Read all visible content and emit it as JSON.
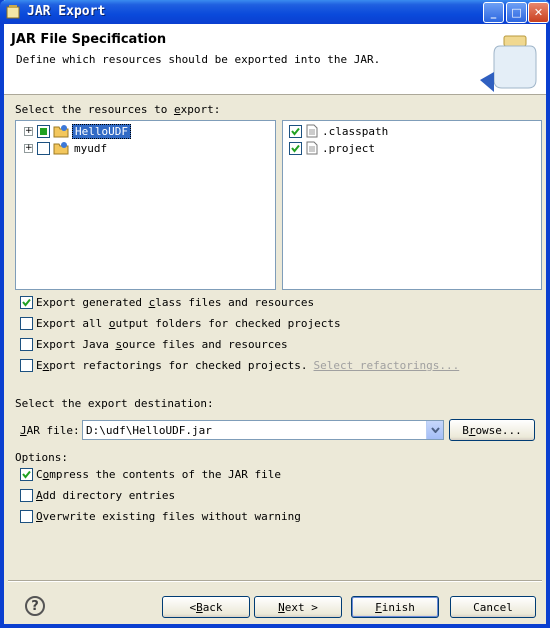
{
  "window": {
    "title": "JAR Export",
    "buttons": {
      "minimize": "_",
      "maximize": "□",
      "close": "✕"
    }
  },
  "header": {
    "title": "JAR File Specification",
    "description": "Define which resources should be exported into the JAR."
  },
  "resources": {
    "label_pre": "Select the resources to ",
    "label_u": "e",
    "label_post": "xport:",
    "projects": [
      {
        "name": "HelloUDF",
        "state": "partial",
        "selected": true,
        "expander": "+"
      },
      {
        "name": "myudf",
        "state": "unchecked",
        "selected": false,
        "expander": "+"
      }
    ],
    "files": [
      {
        "name": ".classpath",
        "checked": true
      },
      {
        "name": ".project",
        "checked": true
      }
    ]
  },
  "export_options": [
    {
      "pre": "Export generated ",
      "u": "c",
      "post": "lass files and resources",
      "checked": true
    },
    {
      "pre": "Export all ",
      "u": "o",
      "post": "utput folders for checked projects",
      "checked": false
    },
    {
      "pre": "Export Java ",
      "u": "s",
      "post": "ource files and resources",
      "checked": false
    },
    {
      "pre": "E",
      "u": "x",
      "post": "port refactorings for checked projects.",
      "checked": false,
      "link": "Select refactorings..."
    }
  ],
  "destination": {
    "label": "Select the export destination:",
    "jar_file_label_u": "J",
    "jar_file_label_post": "AR file:",
    "jar_file_value": "D:\\udf\\HelloUDF.jar",
    "browse_pre": "B",
    "browse_u": "r",
    "browse_post": "owse..."
  },
  "options": {
    "label": "Options:",
    "items": [
      {
        "pre": "C",
        "u": "o",
        "post": "mpress the contents of the JAR file",
        "checked": true
      },
      {
        "pre": "",
        "u": "A",
        "post": "dd directory entries",
        "checked": false
      },
      {
        "pre": "",
        "u": "O",
        "post": "verwrite existing files without warning",
        "checked": false
      }
    ]
  },
  "footer": {
    "help_icon": "?",
    "back_pre": "< ",
    "back_u": "B",
    "back_post": "ack",
    "next_u": "N",
    "next_post": "ext >",
    "finish_u": "F",
    "finish_post": "inish",
    "cancel": "Cancel"
  }
}
